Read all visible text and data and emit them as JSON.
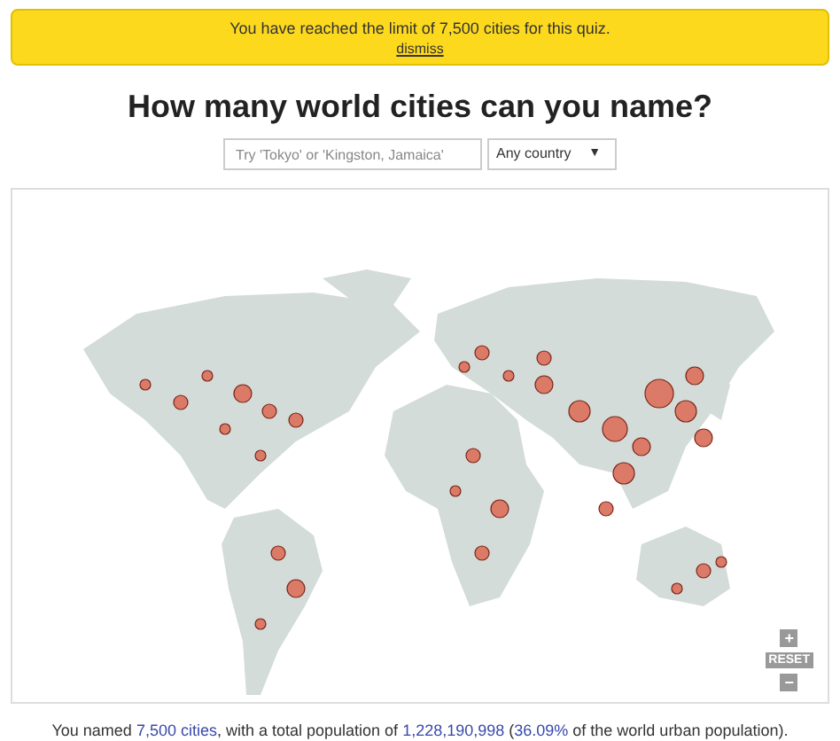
{
  "banner": {
    "message": "You have reached the limit of 7,500 cities for this quiz.",
    "dismiss": "dismiss"
  },
  "title": "How many world cities can you name?",
  "search": {
    "placeholder": "Try 'Tokyo' or 'Kingston, Jamaica'"
  },
  "country_select": {
    "value": "Any country",
    "caret": "▼"
  },
  "map_controls": {
    "zoom_in": "+",
    "reset": "RESET",
    "zoom_out": "−"
  },
  "summary": [
    {
      "text": "You named ",
      "highlight": false
    },
    {
      "text": "7,500 cities",
      "highlight": true
    },
    {
      "text": ", with a total population of ",
      "highlight": false
    },
    {
      "text": "1,228,190,998",
      "highlight": true
    },
    {
      "text": " (",
      "highlight": false
    },
    {
      "text": "36.09%",
      "highlight": true
    },
    {
      "text": " of the world urban population).",
      "highlight": false
    }
  ]
}
